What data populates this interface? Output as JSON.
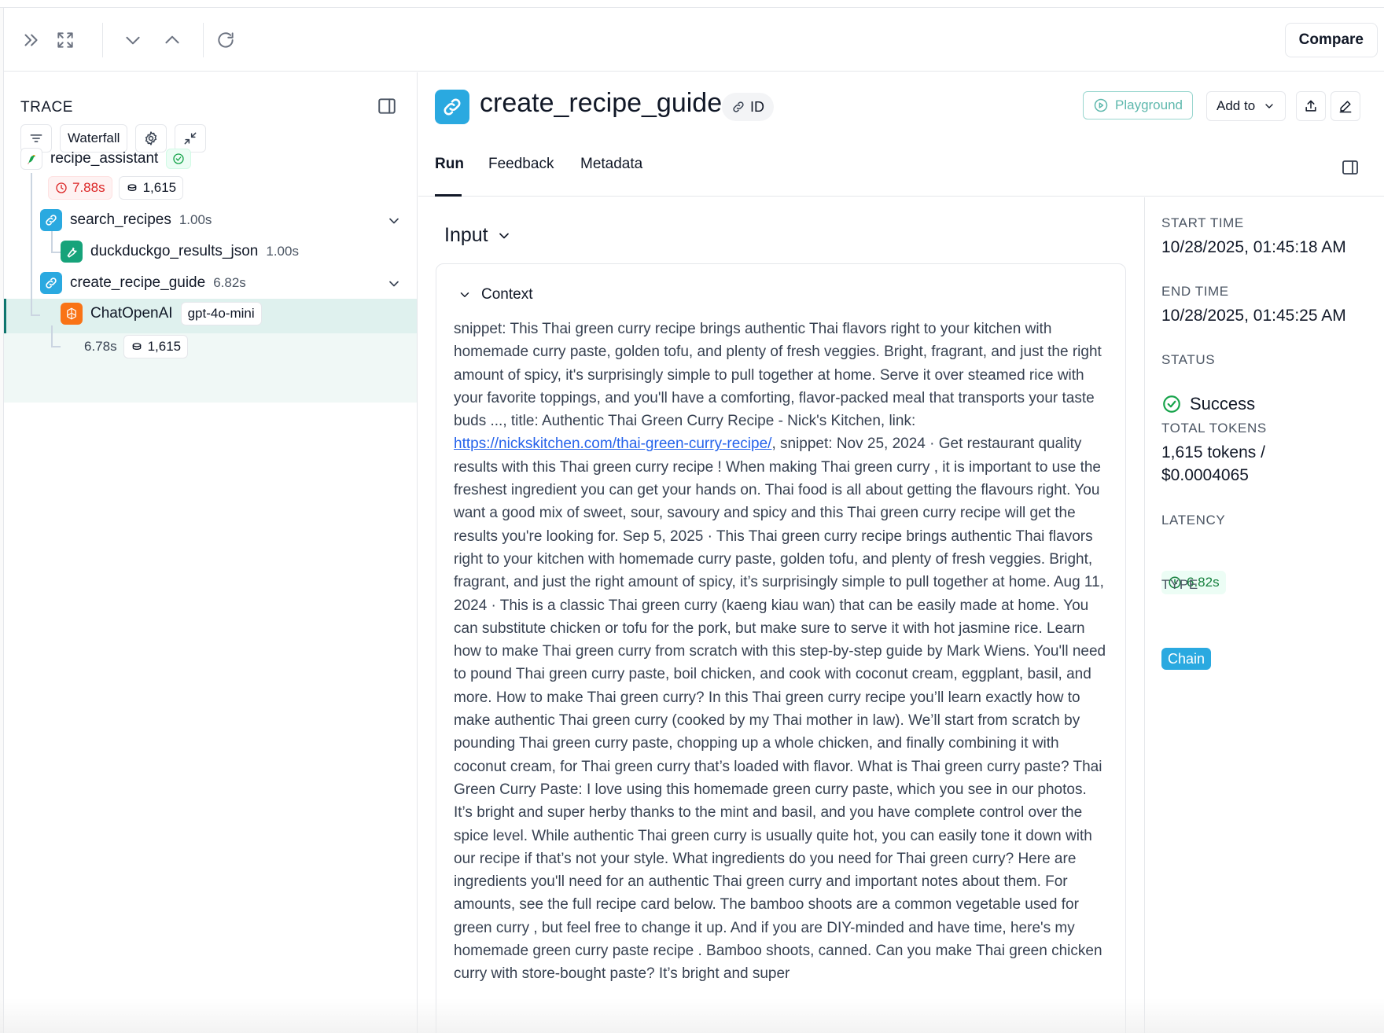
{
  "toolbar": {
    "compare_label": "Compare"
  },
  "trace": {
    "title": "TRACE",
    "view_label": "Waterfall",
    "nodes": {
      "root": {
        "name": "recipe_assistant",
        "duration": "7.88s",
        "tokens": "1,615",
        "icon": "parrot-icon"
      },
      "search": {
        "name": "search_recipes",
        "duration": "1.00s",
        "icon": "link-icon"
      },
      "duck": {
        "name": "duckduckgo_results_json",
        "duration": "1.00s",
        "icon": "wrench-icon"
      },
      "create": {
        "name": "create_recipe_guide",
        "duration": "6.82s",
        "icon": "link-icon"
      },
      "llm": {
        "name": "ChatOpenAI",
        "model": "gpt-4o-mini",
        "duration": "6.78s",
        "tokens": "1,615",
        "icon": "openai-icon"
      }
    }
  },
  "header": {
    "title": "create_recipe_guide",
    "id_label": "ID",
    "playground_label": "Playground",
    "add_to_label": "Add to",
    "tabs": [
      "Run",
      "Feedback",
      "Metadata"
    ]
  },
  "input": {
    "section_title": "Input",
    "context_label": "Context",
    "text_before_link": "snippet: This Thai green curry recipe brings authentic Thai flavors right to your kitchen with homemade curry paste, golden tofu, and plenty of fresh veggies. Bright, fragrant, and just the right amount of spicy, it's surprisingly simple to pull together at home. Serve it over steamed rice with your favorite toppings, and you'll have a comforting, flavor-packed meal that transports your taste buds ..., title: Authentic Thai Green Curry Recipe - Nick's Kitchen, link: ",
    "link_text": "https://nickskitchen.com/thai-green-curry-recipe/",
    "text_after_link": ", snippet: Nov 25, 2024 · Get restaurant quality results with this Thai green curry recipe ! When making Thai green curry , it is important to use the freshest ingredient you can get your hands on. Thai food is all about getting the flavours right. You want a good mix of sweet, sour, savoury and spicy and this Thai green curry recipe will get the results you're looking for. Sep 5, 2025 · This Thai green curry recipe brings authentic Thai flavors right to your kitchen with homemade curry paste, golden tofu, and plenty of fresh veggies. Bright, fragrant, and just the right amount of spicy, it’s surprisingly simple to pull together at home. Aug 11, 2024 · This is a classic Thai green curry (kaeng kiau wan) that can be easily made at home. You can substitute chicken or tofu for the pork, but make sure to serve it with hot jasmine rice. Learn how to make Thai green curry from scratch with this step-by-step guide by Mark Wiens. You'll need to pound Thai green curry paste, boil chicken, and cook with coconut cream, eggplant, basil, and more. How to make Thai green curry? In this Thai green curry recipe you’ll learn exactly how to make authentic Thai green curry (cooked by my Thai mother in law). We’ll start from scratch by pounding Thai green curry paste, chopping up a whole chicken, and finally combining it with coconut cream, for Thai green curry that’s loaded with flavor. What is Thai green curry paste? Thai Green Curry Paste: I love using this homemade green curry paste, which you see in our photos. It’s bright and super herby thanks to the mint and basil, and you have complete control over the spice level. While authentic Thai green curry is usually quite hot, you can easily tone it down with our recipe if that’s not your style. What ingredients do you need for Thai green curry? Here are ingredients you'll need for an authentic Thai green curry and important notes about them. For amounts, see the full recipe card below. The bamboo shoots are a common vegetable used for green curry , but feel free to change it up. And if you are DIY-minded and have time, here's my homemade green curry paste recipe . Bamboo shoots, canned. Can you make Thai green chicken curry with store-bought paste? It’s bright and super"
  },
  "details": {
    "start_time_label": "START TIME",
    "start_time": "10/28/2025, 01:45:18 AM",
    "end_time_label": "END TIME",
    "end_time": "10/28/2025, 01:45:25 AM",
    "status_label": "STATUS",
    "status": "Success",
    "total_tokens_label": "TOTAL TOKENS",
    "total_tokens_line1": "1,615 tokens /",
    "total_tokens_line2": "$0.0004065",
    "latency_label": "LATENCY",
    "latency": "6.82s",
    "type_label": "TYPE",
    "type": "Chain"
  },
  "colors": {
    "accent": "#2aa9e0",
    "selected_row": "#dff1ee",
    "success": "#16a34a",
    "error": "#dc2626",
    "link": "#2563eb"
  }
}
